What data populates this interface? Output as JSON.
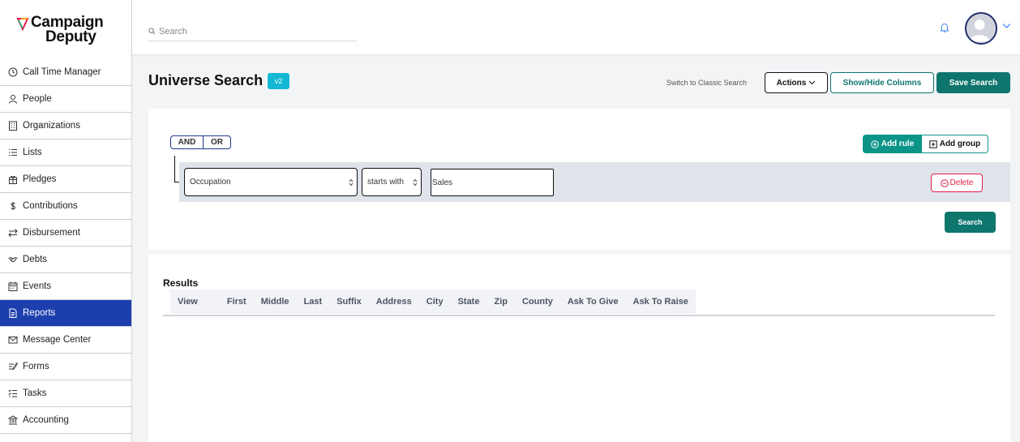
{
  "brand": {
    "line1": "Campaign",
    "line2": "Deputy"
  },
  "sidebar": {
    "items": [
      {
        "label": "Call Time Manager",
        "icon": "clock-icon",
        "active": false
      },
      {
        "label": "People",
        "icon": "person-icon",
        "active": false
      },
      {
        "label": "Organizations",
        "icon": "building-icon",
        "active": false
      },
      {
        "label": "Lists",
        "icon": "list-icon",
        "active": false
      },
      {
        "label": "Pledges",
        "icon": "gift-icon",
        "active": false
      },
      {
        "label": "Contributions",
        "icon": "dollar-icon",
        "active": false
      },
      {
        "label": "Disbursement",
        "icon": "swap-icon",
        "active": false
      },
      {
        "label": "Debts",
        "icon": "handshake-icon",
        "active": false
      },
      {
        "label": "Events",
        "icon": "calendar-icon",
        "active": false
      },
      {
        "label": "Reports",
        "icon": "document-icon",
        "active": true
      },
      {
        "label": "Message Center",
        "icon": "envelope-icon",
        "active": false
      },
      {
        "label": "Forms",
        "icon": "form-icon",
        "active": false
      },
      {
        "label": "Tasks",
        "icon": "checklist-icon",
        "active": false
      },
      {
        "label": "Accounting",
        "icon": "bank-icon",
        "active": false
      }
    ]
  },
  "topbar": {
    "search_placeholder": "Search"
  },
  "header": {
    "title": "Universe Search",
    "badge": "v2",
    "classic_link": "Switch to Classic Search",
    "actions_label": "Actions",
    "showhide_label": "Show/Hide Columns",
    "save_label": "Save Search"
  },
  "query": {
    "and_label": "AND",
    "or_label": "OR",
    "add_rule_label": "Add rule",
    "add_group_label": "Add group",
    "rule": {
      "field": "Occupation",
      "operator": "starts with",
      "value": "Sales"
    },
    "delete_label": "Delete",
    "search_label": "Search"
  },
  "results": {
    "title": "Results",
    "columns": [
      "View",
      "First",
      "Middle",
      "Last",
      "Suffix",
      "Address",
      "City",
      "State",
      "Zip",
      "County",
      "Ask To Give",
      "Ask To Raise"
    ]
  },
  "colors": {
    "accent": "#0f766e",
    "active_nav": "#1d3fae",
    "badge": "#14b8d4",
    "danger": "#e11d48"
  }
}
